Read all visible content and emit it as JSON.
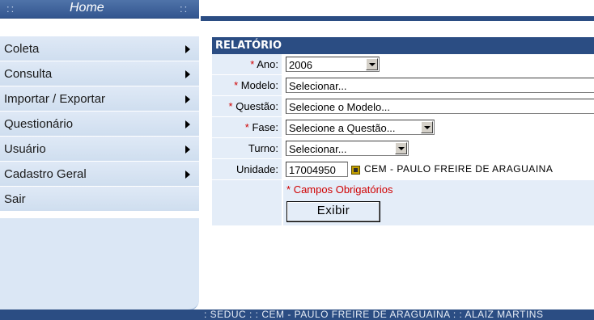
{
  "menu": {
    "home_label": "Home",
    "items": [
      {
        "label": "Coleta",
        "has_submenu": true
      },
      {
        "label": "Consulta",
        "has_submenu": true
      },
      {
        "label": "Importar / Exportar",
        "has_submenu": true
      },
      {
        "label": "Questionário",
        "has_submenu": true
      },
      {
        "label": "Usuário",
        "has_submenu": true
      },
      {
        "label": "Cadastro Geral",
        "has_submenu": true
      },
      {
        "label": "Sair",
        "has_submenu": false
      }
    ]
  },
  "form": {
    "title": "RELATÓRIO",
    "fields": {
      "ano": {
        "label": "Ano:",
        "value": "2006"
      },
      "modelo": {
        "label": "Modelo:",
        "value": "Selecionar..."
      },
      "questao": {
        "label": "Questão:",
        "value": "Selecione o Modelo..."
      },
      "fase": {
        "label": "Fase:",
        "value": "Selecione a Questão..."
      },
      "turno": {
        "label": "Turno:",
        "value": "Selecionar..."
      },
      "unidade": {
        "label": "Unidade:",
        "code": "17004950",
        "name": "CEM - PAULO FREIRE DE ARAGUAINA"
      }
    },
    "required_asterisk": "*",
    "required_note": "Campos Obrigatórios",
    "submit_label": "Exibir"
  },
  "footer": {
    "text": ": SEDUC :   : CEM - PAULO FREIRE DE ARAGUAINA :   : ALAIZ MARTINS"
  },
  "colors": {
    "header_blue": "#2b4d83",
    "menu_bg": "#dbe7f5",
    "label_bg": "#e4edf8",
    "required_red": "#d00000"
  }
}
